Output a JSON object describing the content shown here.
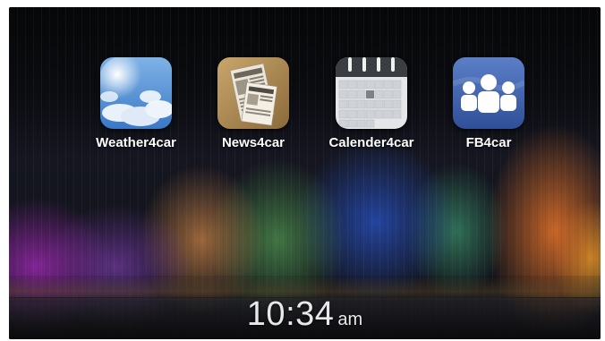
{
  "apps": [
    {
      "label": "Weather4car",
      "icon": "weather-sky-icon"
    },
    {
      "label": "News4car",
      "icon": "newspaper-icon"
    },
    {
      "label": "Calender4car",
      "icon": "calendar-icon"
    },
    {
      "label": "FB4car",
      "icon": "people-icon"
    }
  ],
  "clock": {
    "time": "10:34",
    "ampm": "am"
  },
  "colors": {
    "fb_blue": "#3b5fa8",
    "label_text": "#ffffff",
    "clock_text": "#e8e8ea"
  }
}
